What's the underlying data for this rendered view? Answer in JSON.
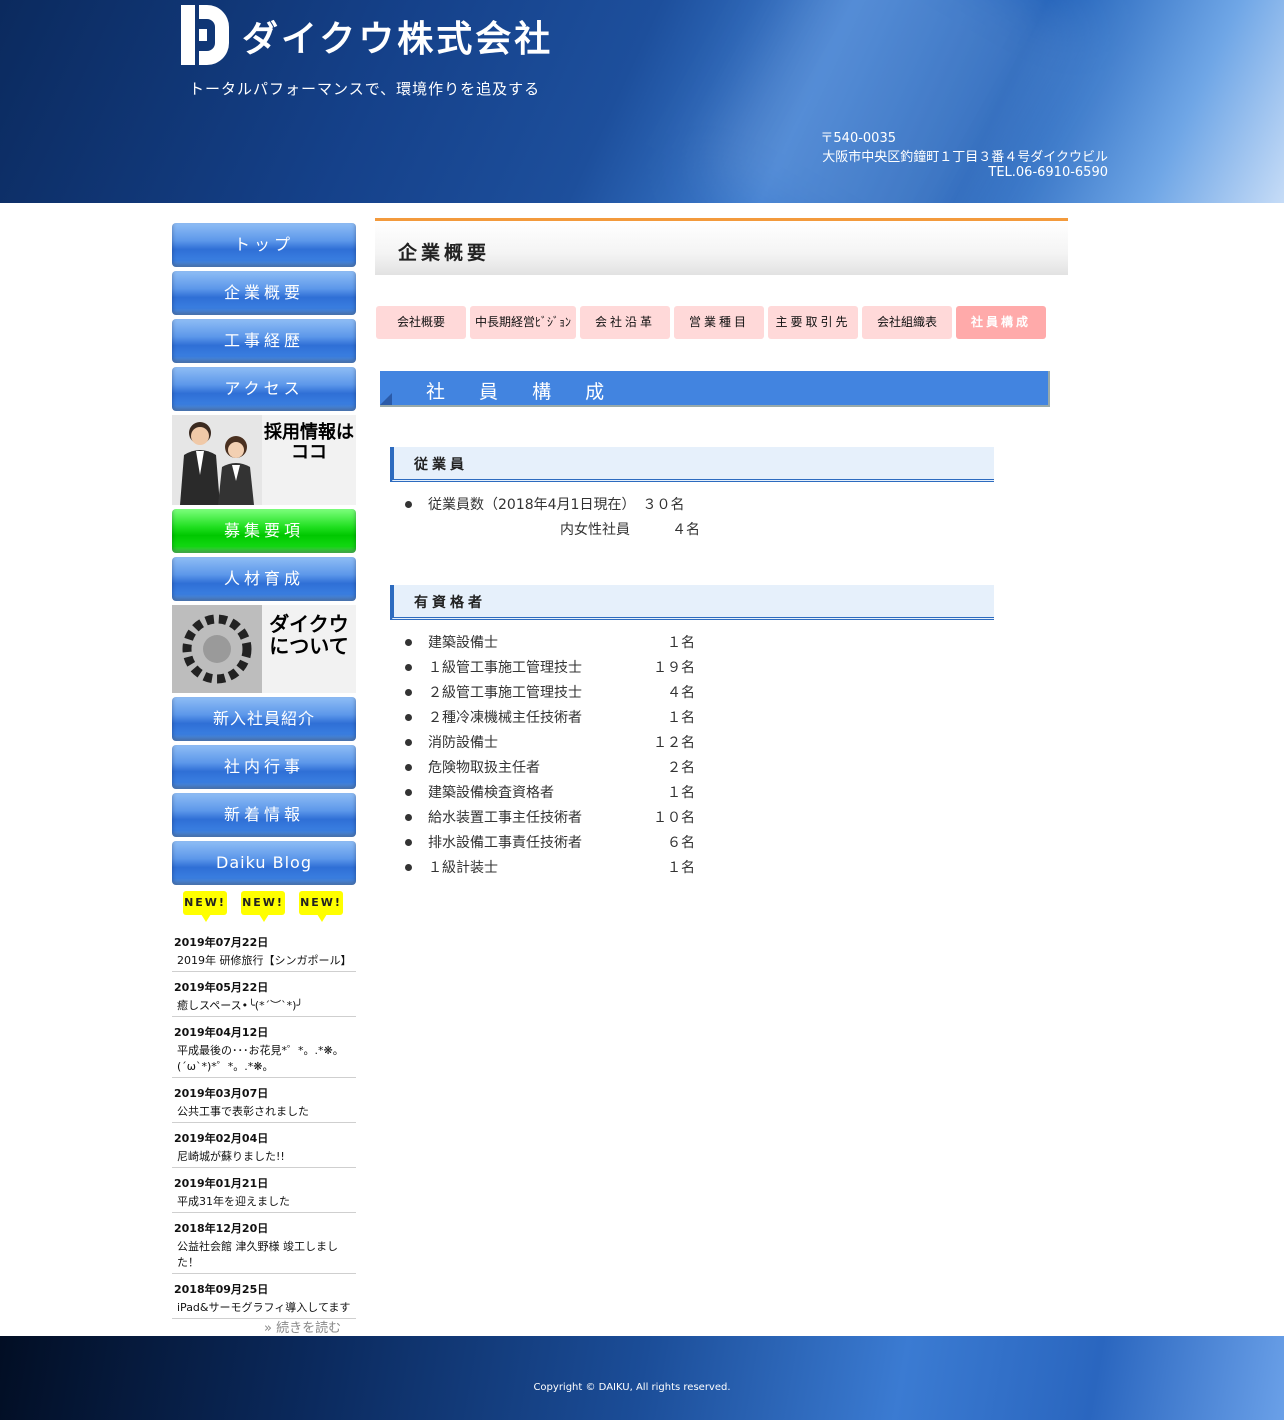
{
  "header": {
    "company_name": "ダイクウ株式会社",
    "tagline": "トータルパフォーマンスで、環境作りを追及する",
    "zip": "〒540-0035",
    "address": "大阪市中央区釣鐘町１丁目３番４号ダイクウビル",
    "tel": "TEL.06-6910-6590"
  },
  "sidebar": {
    "nav": [
      "トップ",
      "企業概要",
      "工事経歴",
      "アクセス"
    ],
    "recruit_banner": "採用情報は\nココ",
    "nav2": [
      "募集要項",
      "人材育成"
    ],
    "about_banner": "ダイクウ\nについて",
    "nav3": [
      "新入社員紹介",
      "社内行事",
      "新着情報",
      "Daiku Blog"
    ],
    "badge": "NEW!",
    "news": [
      {
        "date": "2019年07月22日",
        "title": "2019年 研修旅行【シンガポール】"
      },
      {
        "date": "2019年05月22日",
        "title": "癒しスペース•╰(*´︶`*)╯"
      },
      {
        "date": "2019年04月12日",
        "title": "平成最後の･･･お花見*゜*。.*❋。(´ω`*)*゜*。.*❋。"
      },
      {
        "date": "2019年03月07日",
        "title": "公共工事で表彰されました"
      },
      {
        "date": "2019年02月04日",
        "title": "尼崎城が蘇りました!!"
      },
      {
        "date": "2019年01月21日",
        "title": "平成31年を迎えました"
      },
      {
        "date": "2018年12月20日",
        "title": "公益社会館 津久野様 竣工しました！"
      },
      {
        "date": "2018年09月25日",
        "title": "iPad&サーモグラフィ導入してます"
      }
    ],
    "read_more": "» 続きを読む"
  },
  "main": {
    "page_title": "企業概要",
    "subtabs": [
      "会社概要",
      "中長期経営ﾋﾞｼﾞｮﾝ",
      "会社沿革",
      "営業種目",
      "主要取引先",
      "会社組織表",
      "社員構成"
    ],
    "section_title": "社 員 構 成",
    "employees": {
      "heading": "従業員",
      "line1": "従業員数（2018年4月1日現在）　３０名",
      "line2": "内女性社員　　　４名"
    },
    "qualified": {
      "heading": "有資格者",
      "items": [
        {
          "name": "建築設備士",
          "count": "１名"
        },
        {
          "name": "１級管工事施工管理技士",
          "count": "１９名"
        },
        {
          "name": "２級管工事施工管理技士",
          "count": "４名"
        },
        {
          "name": "２種冷凍機械主任技術者",
          "count": "１名"
        },
        {
          "name": "消防設備士",
          "count": "１２名"
        },
        {
          "name": "危険物取扱主任者",
          "count": "２名"
        },
        {
          "name": "建築設備検査資格者",
          "count": "１名"
        },
        {
          "name": "給水装置工事主任技術者",
          "count": "１０名"
        },
        {
          "name": "排水設備工事責任技術者",
          "count": "６名"
        },
        {
          "name": "１級計装士",
          "count": "１名"
        }
      ]
    }
  },
  "footer": {
    "copyright": "Copyright © DAIKU, All rights reserved."
  },
  "colors": {
    "header_blue": "#15418a",
    "nav_blue": "#3a7ee0",
    "nav_green": "#00c800",
    "section_blue": "#4284e0",
    "tab_pink": "#ffd9d9",
    "tab_active": "#ffaaaa",
    "accent_orange": "#f39a3c",
    "badge_yellow": "#ffff00"
  }
}
